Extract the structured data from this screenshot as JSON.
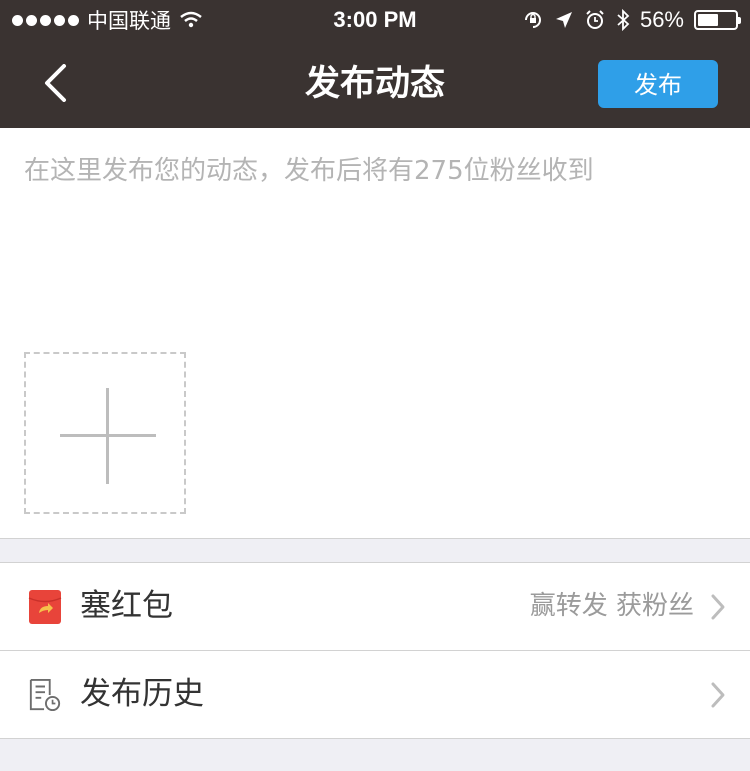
{
  "status_bar": {
    "carrier": "中国联通",
    "time": "3:00 PM",
    "battery": "56%",
    "battery_level": 0.56
  },
  "nav": {
    "title": "发布动态",
    "publish_label": "发布",
    "back_icon": "chevron-left-icon"
  },
  "composer": {
    "placeholder": "在这里发布您的动态，发布后将有275位粉丝收到",
    "add_photo_icon": "plus-icon"
  },
  "options": [
    {
      "label": "塞红包",
      "note": "赢转发 获粉丝",
      "icon": "red-envelope-icon"
    },
    {
      "label": "发布历史",
      "note": "",
      "icon": "history-icon"
    }
  ],
  "colors": {
    "nav_bg": "#3a3331",
    "accent": "#2f9fe8",
    "red_envelope": "#e8443a",
    "page_bg": "#efeff4"
  }
}
